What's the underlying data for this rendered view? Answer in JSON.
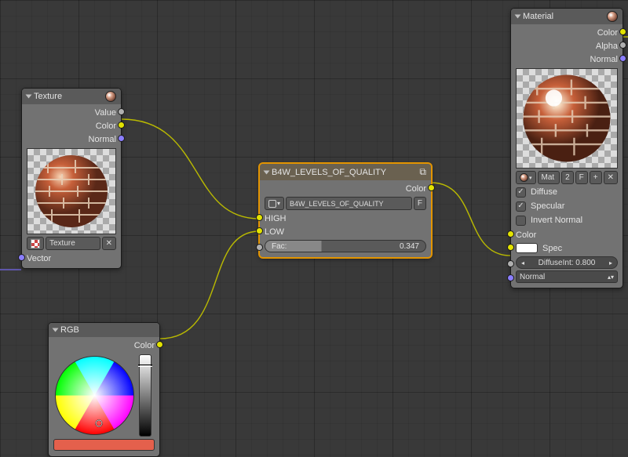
{
  "texture_node": {
    "title": "Texture",
    "outputs": {
      "value": "Value",
      "color": "Color",
      "normal": "Normal"
    },
    "field_label": "Texture",
    "inputs": {
      "vector": "Vector"
    }
  },
  "rgb_node": {
    "title": "RGB",
    "output_label": "Color",
    "swatch_color": "#e4604c"
  },
  "group_node": {
    "title": "B4W_LEVELS_OF_QUALITY",
    "output_label": "Color",
    "group_name": "B4W_LEVELS_OF_QUALITY",
    "f_button": "F",
    "inputs": {
      "high": "HIGH",
      "low": "LOW"
    },
    "fac_label": "Fac:",
    "fac_value": "0.347"
  },
  "material_node": {
    "title": "Material",
    "outputs": {
      "color": "Color",
      "alpha": "Alpha",
      "normal": "Normal"
    },
    "mat_field": {
      "name": "Mat",
      "users": "2",
      "fake": "F",
      "add": "+",
      "del": "✕"
    },
    "diffuse_check": "Diffuse",
    "specular_check": "Specular",
    "invert_normal_check": "Invert Normal",
    "inputs": {
      "color": "Color",
      "spec": "Spec",
      "diffuse_int_label": "DiffuseInt:",
      "diffuse_int_value": "0.800",
      "normal": "Normal"
    },
    "color_swatch": "#ffffff"
  }
}
